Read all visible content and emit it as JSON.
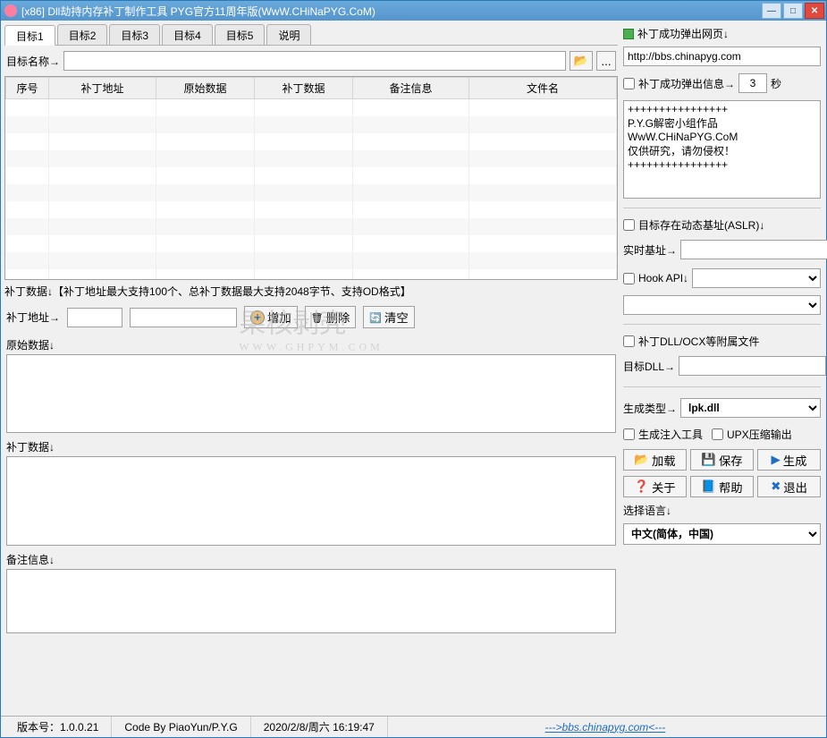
{
  "window": {
    "title": "[x86] Dll劫持内存补丁制作工具   PYG官方11周年版(WwW.CHiNaPYG.CoM)"
  },
  "tabs": [
    "目标1",
    "目标2",
    "目标3",
    "目标4",
    "目标5",
    "说明"
  ],
  "labels": {
    "target_name": "目标名称→",
    "patch_data_hint": "补丁数据↓【补丁地址最大支持100个、总补丁数据最大支持2048字节、支持OD格式】",
    "patch_addr": "补丁地址→",
    "add": "增加",
    "delete": "删除",
    "clear": "清空",
    "original_data": "原始数据↓",
    "patch_data": "补丁数据↓",
    "remark": "备注信息↓"
  },
  "grid_headers": [
    "序号",
    "补丁地址",
    "原始数据",
    "补丁数据",
    "备注信息",
    "文件名"
  ],
  "right": {
    "popup_web": "补丁成功弹出网页↓",
    "popup_url": "http://bbs.chinapyg.com",
    "popup_info": "补丁成功弹出信息→",
    "seconds_value": "3",
    "seconds_suffix": "秒",
    "popup_text": "++++++++++++++++\nP.Y.G解密小组作品\nWwW.CHiNaPYG.CoM\n仅供研究，请勿侵权！\n++++++++++++++++",
    "aslr": "目标存在动态基址(ASLR)↓",
    "realtime_base": "实时基址→",
    "hook_api": "Hook API↓",
    "dll_ocx": "补丁DLL/OCX等附属文件",
    "target_dll": "目标DLL→",
    "gen_type": "生成类型→",
    "gen_type_value": "lpk.dll",
    "gen_inject": "生成注入工具",
    "upx": "UPX压缩输出",
    "load": "加载",
    "save": "保存",
    "generate": "生成",
    "about": "关于",
    "help": "帮助",
    "exit": "退出",
    "lang_label": "选择语言↓",
    "lang_value": "中文(简体，中国)"
  },
  "status": {
    "version_label": "版本号：",
    "version": "1.0.0.21",
    "code_by": "Code By PiaoYun/P.Y.G",
    "datetime": "2020/2/8/周六 16:19:47",
    "link": "--->bbs.chinapyg.com<---"
  },
  "watermark": {
    "main": "果核剥壳",
    "sub": "WWW.GHPYM.COM"
  }
}
